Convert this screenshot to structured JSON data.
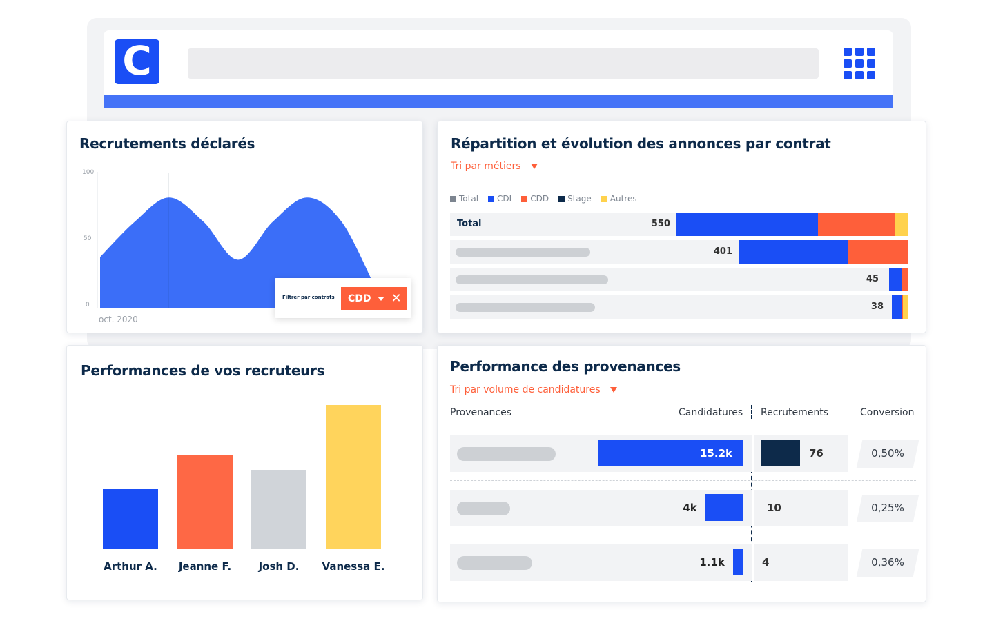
{
  "browser": {
    "logo_letter": "C",
    "brand_color": "#1a4ef5",
    "apps_icon": "grid-apps-icon"
  },
  "recruitments": {
    "title": "Recrutements déclarés",
    "y_ticks": [
      "100",
      "50",
      "0"
    ],
    "x_tick": "oct. 2020",
    "filter": {
      "label": "Filtrer par contrats",
      "chip_label": "CDD",
      "chip_color": "#fe5f3a"
    },
    "chart_data": {
      "type": "area",
      "ylim": [
        0,
        100
      ],
      "x": [
        0,
        1,
        2,
        3,
        4,
        5,
        6,
        7,
        8
      ],
      "values": [
        38,
        64,
        82,
        64,
        36,
        64,
        82,
        64,
        14
      ],
      "x_tick_labels": [
        "oct. 2020"
      ],
      "color": "#3b6ef8"
    }
  },
  "repartition": {
    "title": "Répartition et évolution des annonces par contrat",
    "sort_label": "Tri par métiers",
    "legend": [
      {
        "name": "Total",
        "color": "#7d8590"
      },
      {
        "name": "CDI",
        "color": "#1a4ef5"
      },
      {
        "name": "CDD",
        "color": "#fe5f3a"
      },
      {
        "name": "Stage",
        "color": "#0d2a4a"
      },
      {
        "name": "Autres",
        "color": "#ffd24d"
      }
    ],
    "rows": [
      {
        "label": "Total",
        "value": "550"
      },
      {
        "label": "",
        "value": "401"
      },
      {
        "label": "",
        "value": "45"
      },
      {
        "label": "",
        "value": "38"
      }
    ],
    "chart_data": {
      "type": "bar",
      "orientation": "horizontal",
      "stacked": true,
      "categories": [
        "Total",
        "",
        "",
        ""
      ],
      "totals": [
        550,
        401,
        45,
        38
      ],
      "series": [
        {
          "name": "CDI",
          "values": [
            336,
            260,
            30,
            24
          ]
        },
        {
          "name": "CDD",
          "values": [
            183,
            141,
            15,
            3
          ]
        },
        {
          "name": "Stage",
          "values": [
            0,
            0,
            0,
            0
          ]
        },
        {
          "name": "Autres",
          "values": [
            31,
            0,
            0,
            11
          ]
        }
      ]
    }
  },
  "recruiters": {
    "title": "Performances de vos recruteurs",
    "chart_data": {
      "type": "bar",
      "categories": [
        "Arthur A.",
        "Jeanne F.",
        "Josh D.",
        "Vanessa E."
      ],
      "values": [
        86,
        136,
        114,
        208
      ],
      "colors": [
        "#1a4ef5",
        "#fe6845",
        "#d0d4d9",
        "#ffd45c"
      ]
    }
  },
  "provenances": {
    "title": "Performance des provenances",
    "sort_label": "Tri par volume de candidatures",
    "columns": {
      "source": "Provenances",
      "applications": "Candidatures",
      "hires": "Recrutements",
      "conversion": "Conversion"
    },
    "rows": [
      {
        "applications": "15.2k",
        "applications_value": 15200,
        "hires": "76",
        "conversion": "0,50%"
      },
      {
        "applications": "4k",
        "applications_value": 4000,
        "hires": "10",
        "conversion": "0,25%"
      },
      {
        "applications": "1.1k",
        "applications_value": 1100,
        "hires": "4",
        "conversion": "0,36%"
      }
    ]
  }
}
